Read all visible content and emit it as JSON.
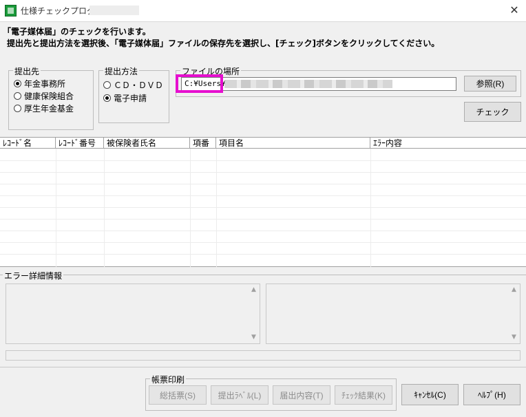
{
  "window": {
    "title": "仕様チェックプログラム",
    "close_glyph": "✕"
  },
  "instructions": {
    "line1": "「電子媒体届」のチェックを行います。",
    "line2": "提出先と提出方法を選択後、「電子媒体届」ファイルの保存先を選択し、[チェック]ボタンをクリックしてください。"
  },
  "submit_to": {
    "legend": "提出先",
    "options": [
      {
        "label": "年金事務所",
        "selected": true
      },
      {
        "label": "健康保険組合",
        "selected": false
      },
      {
        "label": "厚生年金基金",
        "selected": false
      }
    ]
  },
  "submit_method": {
    "legend": "提出方法",
    "options": [
      {
        "label": "ＣＤ・ＤＶＤ",
        "selected": false
      },
      {
        "label": "電子申請",
        "selected": true
      }
    ]
  },
  "file_location": {
    "legend": "ファイルの場所",
    "path_value": "C:¥Users¥",
    "browse_label": "参照(R)"
  },
  "check_button": "チェック",
  "grid": {
    "columns": [
      "ﾚｺｰﾄﾞ名",
      "ﾚｺｰﾄﾞ番号",
      "被保険者氏名",
      "項番",
      "項目名",
      "ｴﾗｰ内容"
    ],
    "rows": []
  },
  "error_detail": {
    "legend": "エラー詳細情報"
  },
  "print_group": {
    "legend": "帳票印刷",
    "buttons": [
      "総括票(S)",
      "提出ﾗﾍﾞﾙ(L)",
      "届出内容(T)",
      "ﾁｪｯｸ結果(K)"
    ]
  },
  "cancel_button": "ｷｬﾝｾﾙ(C)",
  "help_button": "ﾍﾙﾌﾟ(H)",
  "colors": {
    "highlight": "#e60fcf",
    "app_icon": "#1a9a3a"
  }
}
